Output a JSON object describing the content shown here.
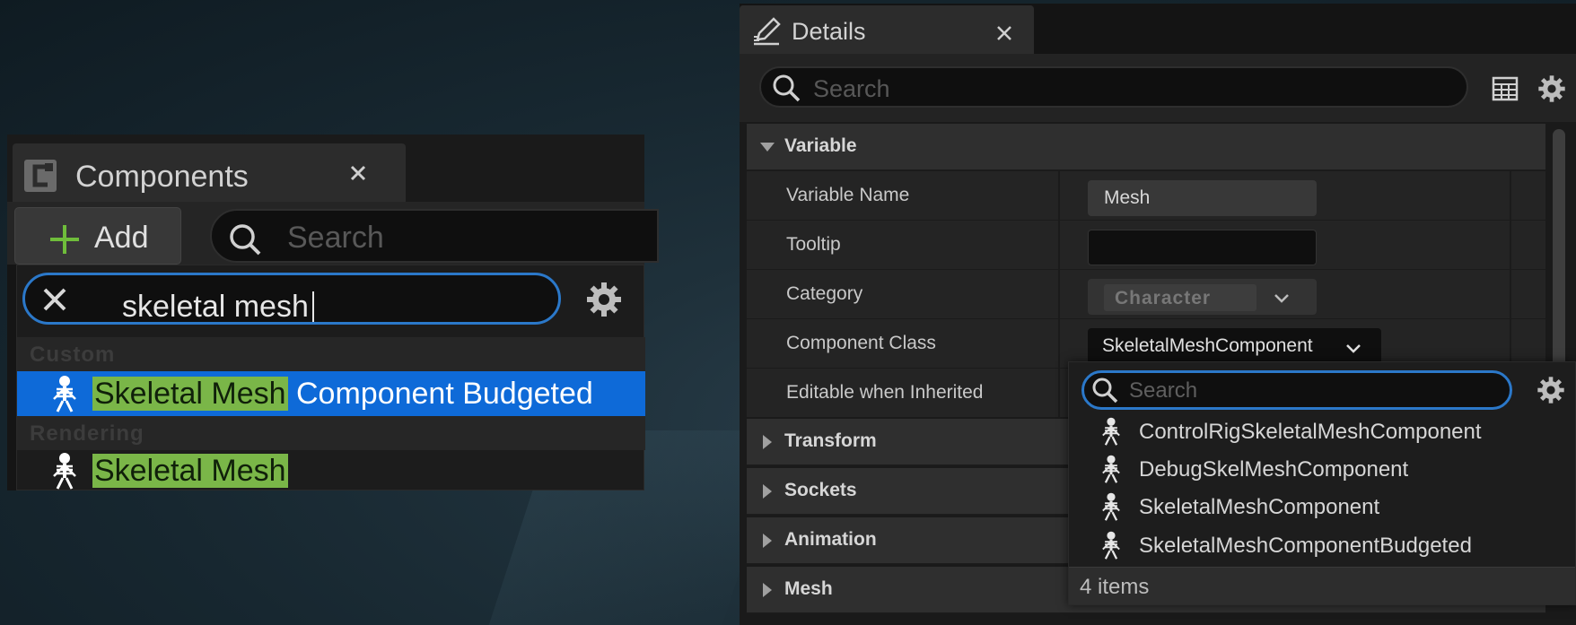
{
  "components_panel": {
    "tab_title": "Components",
    "add_label": "Add",
    "search_placeholder": "Search",
    "popup": {
      "query": "skeletal mesh",
      "categories": [
        {
          "label": "Custom",
          "items": [
            {
              "highlight": "Skeletal Mesh",
              "rest": " Component Budgeted",
              "selected": true
            }
          ]
        },
        {
          "label": "Rendering",
          "items": [
            {
              "highlight": "Skeletal Mesh",
              "rest": "",
              "selected": false
            }
          ]
        }
      ]
    }
  },
  "details_panel": {
    "tab_title": "Details",
    "search_placeholder": "Search",
    "variable_category": "Variable",
    "properties": [
      {
        "name": "Variable Name",
        "value": "Mesh"
      },
      {
        "name": "Tooltip",
        "value": ""
      },
      {
        "name": "Category",
        "value": "Character"
      },
      {
        "name": "Component Class",
        "value": "SkeletalMeshComponent"
      },
      {
        "name": "Editable when Inherited",
        "value": ""
      }
    ],
    "collapsed_categories": [
      "Transform",
      "Sockets",
      "Animation",
      "Mesh"
    ],
    "class_picker": {
      "search_placeholder": "Search",
      "items": [
        "ControlRigSkeletalMeshComponent",
        "DebugSkelMeshComponent",
        "SkeletalMeshComponent",
        "SkeletalMeshComponentBudgeted"
      ],
      "count_label": "4 items"
    }
  },
  "colors": {
    "accent_blue": "#2b78c9",
    "selection_blue": "#0e6ad8",
    "highlight_green": "#7ab648",
    "plus_green": "#6fbd3b"
  },
  "icons": [
    "blueprint-c-icon",
    "close-icon",
    "plus-icon",
    "search-icon",
    "clear-x-icon",
    "gear-icon",
    "skeleton-icon",
    "pencil-icon",
    "grid-icon",
    "chevron-down-icon",
    "triangle-right-icon",
    "triangle-down-icon"
  ]
}
